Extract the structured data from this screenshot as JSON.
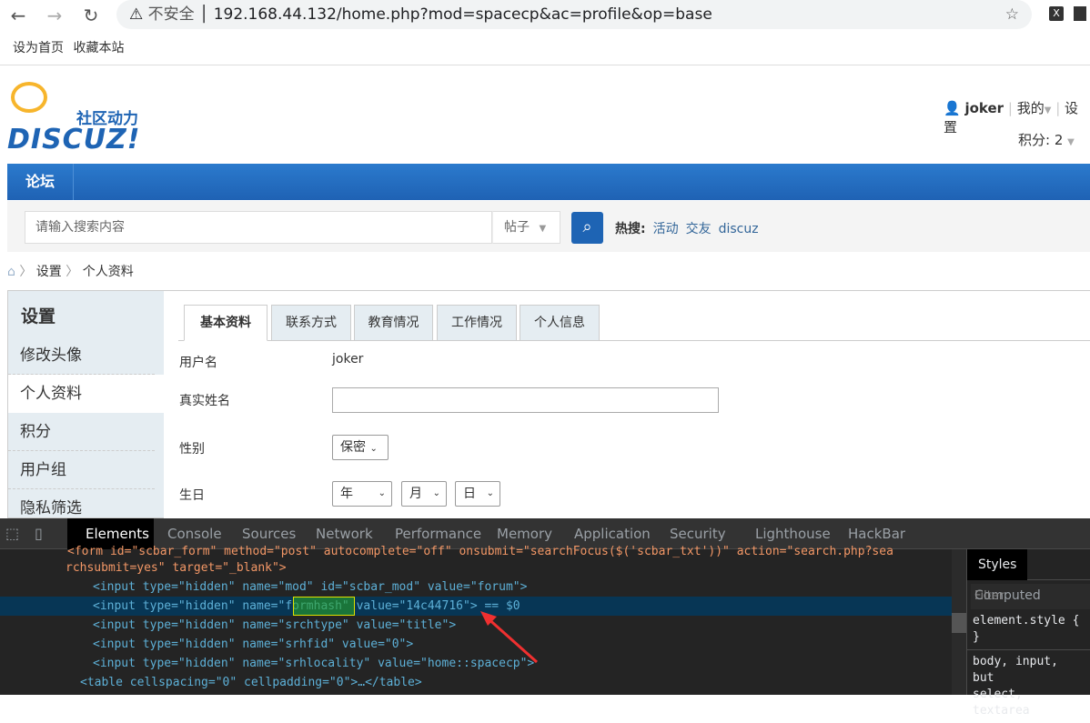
{
  "browser": {
    "security": "不安全",
    "url": "192.168.44.132/home.php?mod=spacecp&ac=profile&op=base",
    "bookmarks": [
      "设为首页",
      "收藏本站"
    ]
  },
  "header": {
    "logo_text": "社区动力",
    "logo_brand": "DISCUZ!",
    "username": "joker",
    "my": "我的",
    "settings": "设置",
    "points": "积分: 2"
  },
  "nav": {
    "forum": "论坛"
  },
  "search": {
    "placeholder": "请输入搜索内容",
    "type": "帖子",
    "hot_label": "热搜:",
    "hot": [
      "活动",
      "交友",
      "discuz"
    ]
  },
  "breadcrumb": [
    "设置",
    "个人资料"
  ],
  "sidebar": {
    "title": "设置",
    "items": [
      "修改头像",
      "个人资料",
      "积分",
      "用户组",
      "隐私筛选"
    ]
  },
  "tabs": [
    "基本资料",
    "联系方式",
    "教育情况",
    "工作情况",
    "个人信息"
  ],
  "form": {
    "username_label": "用户名",
    "username": "joker",
    "realname_label": "真实姓名",
    "gender_label": "性别",
    "gender": "保密",
    "birthday_label": "生日",
    "year": "年",
    "month": "月",
    "day": "日"
  },
  "devtools": {
    "tabs": [
      "Elements",
      "Console",
      "Sources",
      "Network",
      "Performance",
      "Memory",
      "Application",
      "Security",
      "Lighthouse",
      "HackBar"
    ],
    "lines": [
      "<form id=\"scbar_form\" method=\"post\" autocomplete=\"off\" onsubmit=\"searchFocus($('scbar_txt'))\" action=\"search.php?sea",
      "rchsubmit=yes\" target=\"_blank\">",
      "<input type=\"hidden\" name=\"mod\" id=\"scbar_mod\" value=\"forum\">",
      "<input type=\"hidden\" name=\"formhash\" value=\"14c44716\"> == $0",
      "<input type=\"hidden\" name=\"srchtype\" value=\"title\">",
      "<input type=\"hidden\" name=\"srhfid\" value=\"0\">",
      "<input type=\"hidden\" name=\"srhlocality\" value=\"home::spacecp\">",
      "<table cellspacing=\"0\" cellpadding=\"0\">…</table>"
    ],
    "styles_tabs": [
      "Styles",
      "Computed"
    ],
    "filter": "Filter",
    "styles": [
      "element.style {",
      "}",
      "body, input, but",
      "select, textarea"
    ]
  }
}
